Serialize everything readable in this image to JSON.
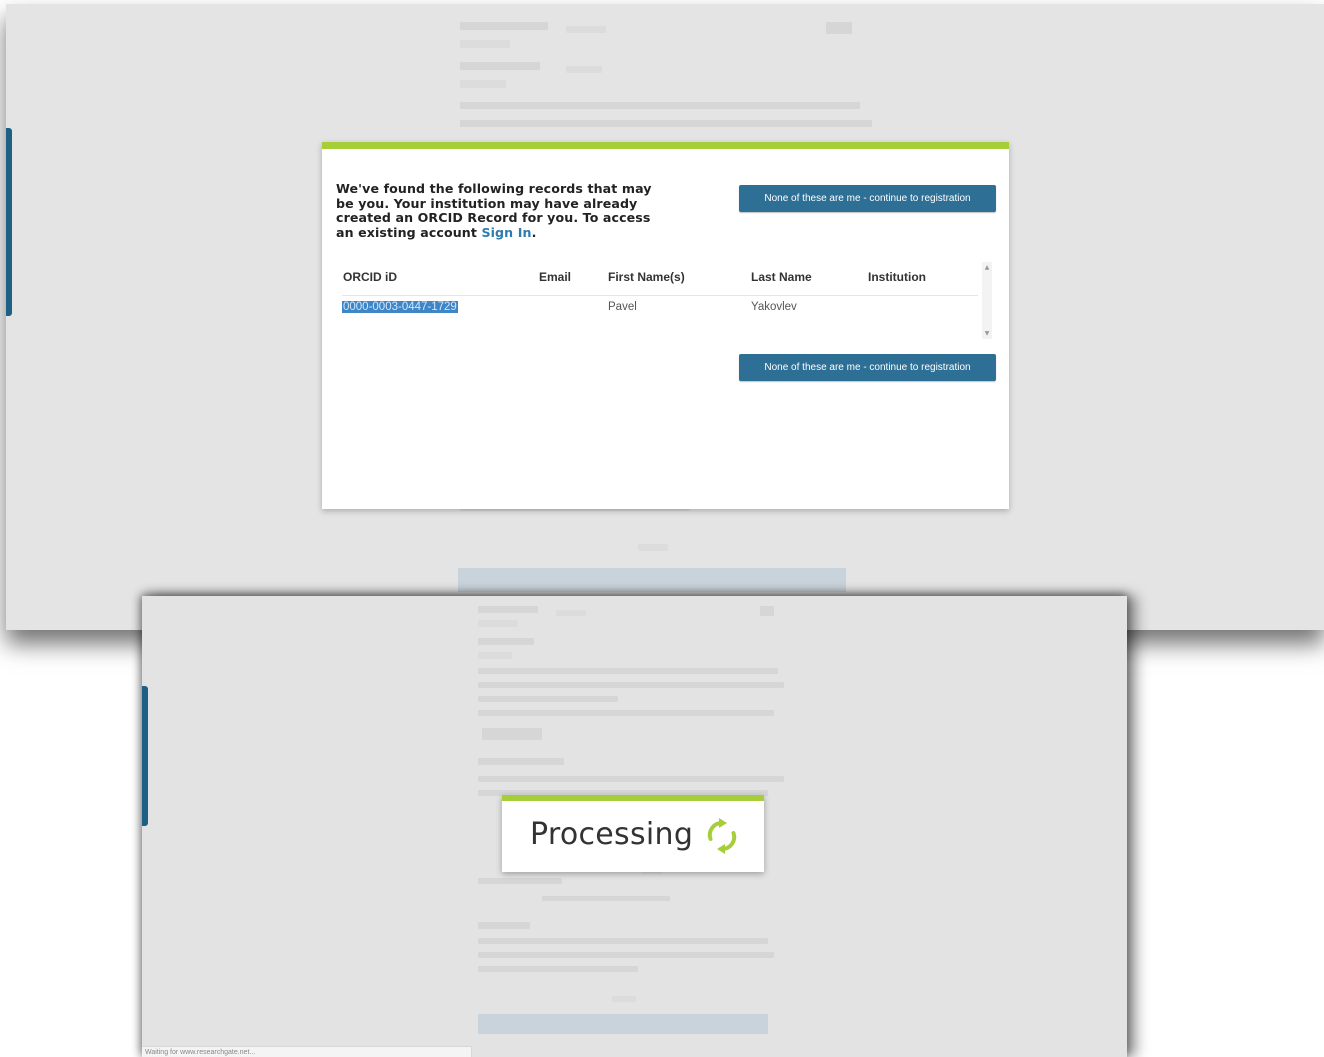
{
  "modal": {
    "message": "We've found the following records that may be you. Your institution may have already created an ORCID Record for you. To access an existing account",
    "sign_in_link": "Sign In",
    "message_end": ".",
    "register_button_label": "None of these are me - continue to registration",
    "table": {
      "headers": [
        "ORCID iD",
        "Email",
        "First Name(s)",
        "Last Name",
        "Institution"
      ],
      "rows": [
        {
          "orcid_id": "0000-0003-0447-1729",
          "email": "",
          "first_name": "Pavel",
          "last_name": "Yakovlev",
          "institution": ""
        }
      ]
    }
  },
  "processing": {
    "label": "Processing",
    "icon": "refresh-spinner-icon"
  },
  "status_bar": {
    "text": "Waiting for www.researchgate.net..."
  },
  "colors": {
    "accent_green": "#a6ce39",
    "button_blue": "#2e6f96",
    "link_blue": "#2e7bb0",
    "overlay_gray": "#e4e4e4"
  }
}
